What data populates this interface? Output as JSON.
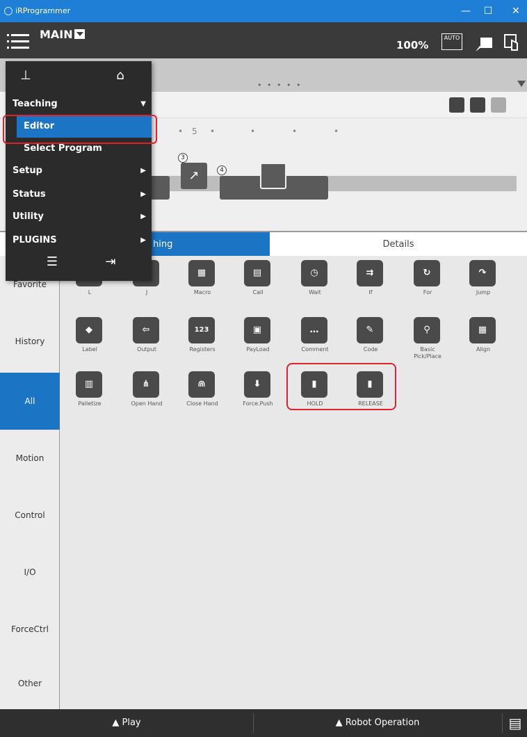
{
  "window": {
    "title": "iRProgrammer",
    "controls": [
      "—",
      "☐",
      "✕"
    ]
  },
  "header": {
    "program": "MAIN",
    "zoom": "100%",
    "auto_badge": "AUTO"
  },
  "timeline": {
    "dots": "• • • • •",
    "ruler_label": "5",
    "steps": [
      "3",
      "4"
    ]
  },
  "tabs": {
    "teaching": "hing",
    "details": "Details"
  },
  "menu": {
    "teaching": "Teaching",
    "editor": "Editor",
    "select_program": "Select Program",
    "setup": "Setup",
    "status": "Status",
    "utility": "Utility",
    "plugins": "PLUGINS"
  },
  "categories": [
    "Favorite",
    "History",
    "All",
    "Motion",
    "Control",
    "I/O",
    "ForceCtrl",
    "Other"
  ],
  "palette": {
    "row1": [
      "L",
      "J",
      "Macro",
      "Call",
      "Wait",
      "If",
      "For",
      "Jump"
    ],
    "row2": [
      "Label",
      "Output",
      "Registers",
      "PayLoad",
      "Comment",
      "Code",
      "Basic Pick/Place",
      "Align"
    ],
    "row3": [
      "Palletize",
      "Open Hand",
      "Close Hand",
      "Force.Push",
      "HOLD",
      "RELEASE"
    ]
  },
  "bottom": {
    "play": "▲ Play",
    "robot_operation": "▲ Robot Operation"
  }
}
